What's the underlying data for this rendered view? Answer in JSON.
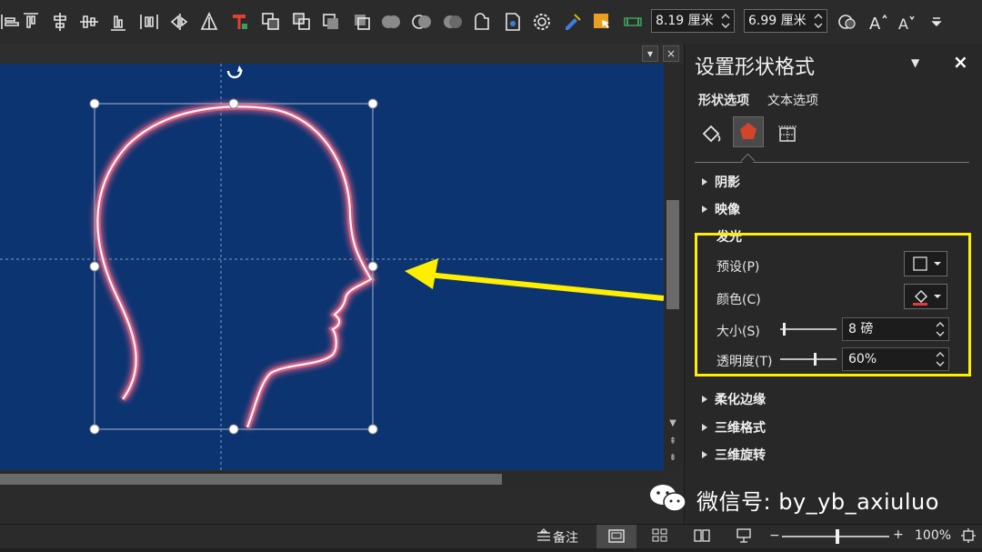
{
  "toolbar": {
    "width_value": "8.19 厘米",
    "height_value": "6.99 厘米"
  },
  "pane": {
    "title": "设置形状格式",
    "tabs": [
      {
        "label": "形状选项"
      },
      {
        "label": "文本选项"
      }
    ],
    "sections": {
      "shadow": "阴影",
      "reflection": "映像",
      "glow": "发光",
      "soft_edges": "柔化边缘",
      "format_3d": "三维格式",
      "rotation_3d": "三维旋转"
    },
    "glow": {
      "preset_label": "预设(P)",
      "color_label": "颜色(C)",
      "size_label": "大小(S)",
      "size_value": "8 磅",
      "size_level": 0.05,
      "transparency_label": "透明度(T)",
      "transparency_value": "60%",
      "transparency_level": 0.6,
      "color_hex": "#e03c3c"
    }
  },
  "statusbar": {
    "notes_label": "备注",
    "zoom_label": "100%",
    "zoom_level": 0.5
  },
  "watermark": {
    "text": "微信号: by_yb_axiuluo"
  },
  "colors": {
    "slide_bg": "#0b3470",
    "highlight_box": "#ffee00",
    "arrow": "#ffee00",
    "glow_line": "#ff6a8a"
  }
}
